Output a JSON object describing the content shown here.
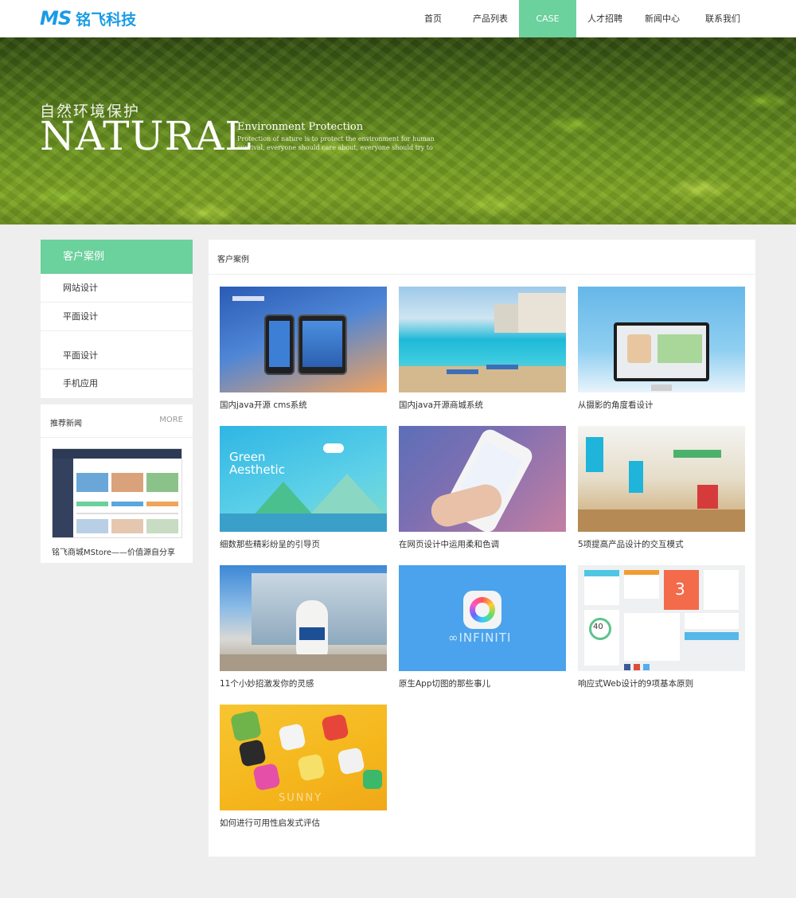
{
  "header": {
    "logo_mark": "MS",
    "logo_text": "铭飞科技",
    "nav": [
      {
        "label": "首页",
        "active": false
      },
      {
        "label": "产品列表",
        "active": false
      },
      {
        "label": "CASE",
        "active": true
      },
      {
        "label": "人才招聘",
        "active": false
      },
      {
        "label": "新闻中心",
        "active": false
      },
      {
        "label": "联系我们",
        "active": false
      }
    ]
  },
  "banner": {
    "cn_title": "自然环境保护",
    "big_title": "NATURAL",
    "subtitle": "Environment Protection",
    "description": "Protection of nature is to protect the environment for human survival, everyone should care about, everyone should try to"
  },
  "sidebar": {
    "heading": "客户案例",
    "items": [
      {
        "label": "网站设计"
      },
      {
        "label": "平面设计"
      },
      {
        "label": "平面设计"
      },
      {
        "label": "手机应用"
      }
    ],
    "news": {
      "title": "推荐新闻",
      "more": "MORE",
      "caption": "铭飞商城MStore——价值源自分享"
    }
  },
  "main": {
    "title": "客户案例",
    "cases": [
      {
        "caption": "国内java开源 cms系统",
        "thumb": "phones"
      },
      {
        "caption": "国内java开源商城系统",
        "thumb": "pool"
      },
      {
        "caption": "从摄影的角度看设计",
        "thumb": "imac"
      },
      {
        "caption": "细数那些精彩纷呈的引导页",
        "thumb": "green-aesthetic",
        "thumb_text_1": "Green",
        "thumb_text_2": "Aesthetic"
      },
      {
        "caption": "在网页设计中运用柔和色调",
        "thumb": "hand-phone"
      },
      {
        "caption": "5项提高产品设计的交互模式",
        "thumb": "town"
      },
      {
        "caption": "11个小妙招激发你的灵感",
        "thumb": "bear"
      },
      {
        "caption": "原生App切图的那些事儿",
        "thumb": "infiniti",
        "thumb_text": "∞INFINITI"
      },
      {
        "caption": "响应式Web设计的9项基本原则",
        "thumb": "ui-kit",
        "thumb_number": "3",
        "thumb_stat": "40"
      },
      {
        "caption": "如何进行可用性启发式评估",
        "thumb": "sunny",
        "thumb_text": "SUNNY"
      }
    ]
  },
  "colors": {
    "accent": "#6bd19d",
    "brand": "#1a9be6",
    "background": "#eeeeee"
  }
}
